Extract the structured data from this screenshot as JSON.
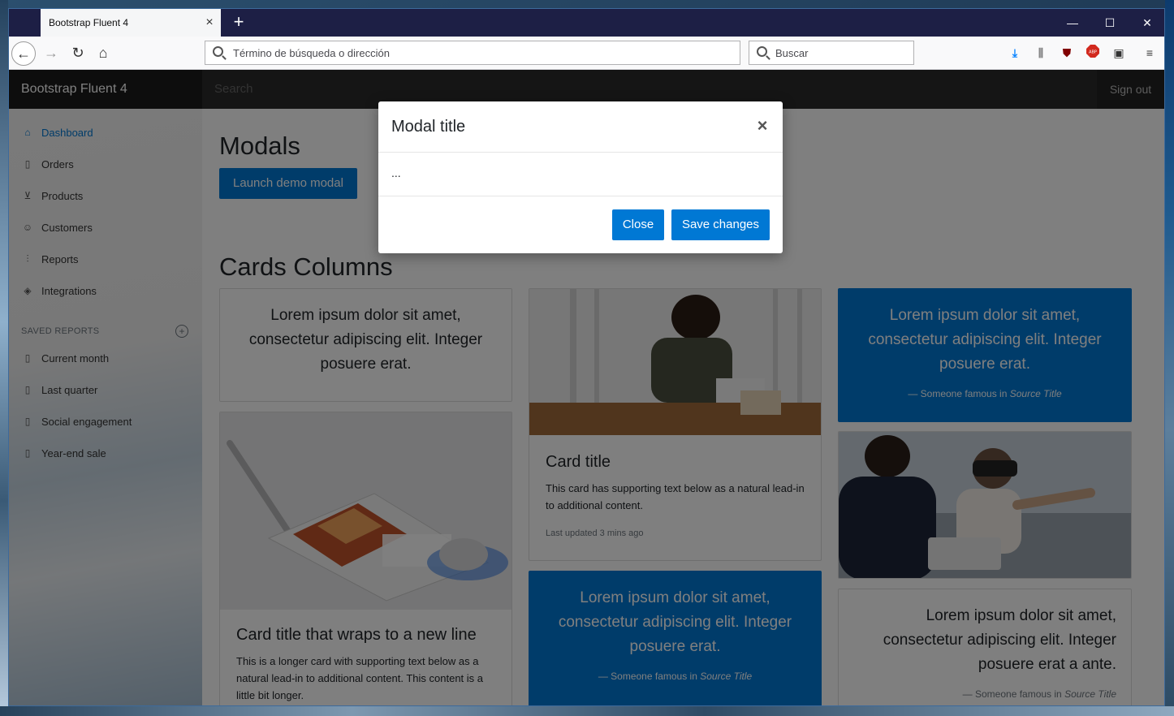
{
  "browser": {
    "tab_title": "Bootstrap Fluent 4",
    "url_placeholder": "Término de búsqueda o dirección",
    "search_placeholder": "Buscar"
  },
  "topnav": {
    "brand": "Bootstrap Fluent 4",
    "search_placeholder": "Search",
    "signout": "Sign out"
  },
  "sidebar": {
    "items": [
      {
        "label": "Dashboard",
        "icon": "home-icon"
      },
      {
        "label": "Orders",
        "icon": "file-icon"
      },
      {
        "label": "Products",
        "icon": "cart-icon"
      },
      {
        "label": "Customers",
        "icon": "users-icon"
      },
      {
        "label": "Reports",
        "icon": "bar-chart-icon"
      },
      {
        "label": "Integrations",
        "icon": "layers-icon"
      }
    ],
    "saved_heading": "SAVED REPORTS",
    "saved": [
      {
        "label": "Current month"
      },
      {
        "label": "Last quarter"
      },
      {
        "label": "Social engagement"
      },
      {
        "label": "Year-end sale"
      }
    ]
  },
  "main": {
    "modals_heading": "Modals",
    "launch_label": "Launch demo modal",
    "cards_heading": "Cards Columns",
    "card1_quote": "Lorem ipsum dolor sit amet, consectetur adipiscing elit. Integer posuere erat.",
    "card2_title": "Card title that wraps to a new line",
    "card2_text": "This is a longer card with supporting text below as a natural lead-in to additional content. This content is a little bit longer.",
    "card3_title": "Card title",
    "card3_text": "This card has supporting text below as a natural lead-in to additional content.",
    "card3_small": "Last updated 3 mins ago",
    "card4_quote": "Lorem ipsum dolor sit amet, consectetur adipiscing elit. Integer posuere erat.",
    "card4_foot_prefix": "— Someone famous in ",
    "card4_foot_source": "Source Title",
    "card5_quote": "Lorem ipsum dolor sit amet, consectetur adipiscing elit. Integer posuere erat.",
    "card5_foot_prefix": "— Someone famous in ",
    "card5_foot_source": "Source Title",
    "card6_quote": "Lorem ipsum dolor sit amet, consectetur adipiscing elit. Integer posuere erat a ante.",
    "card6_foot_prefix": "— Someone famous in ",
    "card6_foot_source": "Source Title"
  },
  "modal": {
    "title": "Modal title",
    "body": "...",
    "close_label": "Close",
    "save_label": "Save changes"
  },
  "colors": {
    "accent": "#0078d4",
    "titlebar": "#1d1f45"
  }
}
